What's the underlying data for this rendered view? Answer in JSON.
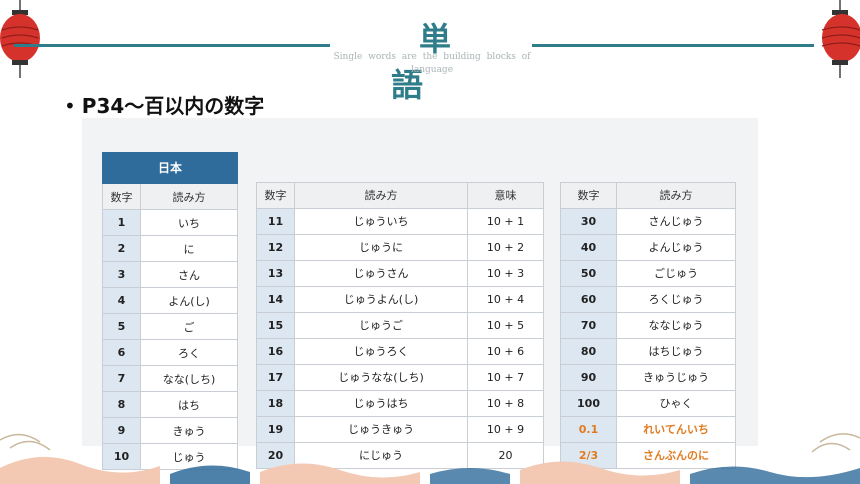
{
  "header": {
    "title": "単　語",
    "subtitle": "Single words are the building blocks of language"
  },
  "bullet": {
    "text": "P34～百以内の数字"
  },
  "table1": {
    "group_label": "日本",
    "headers": [
      "数字",
      "読み方"
    ],
    "rows": [
      [
        "1",
        "いち"
      ],
      [
        "2",
        "に"
      ],
      [
        "3",
        "さん"
      ],
      [
        "4",
        "よん(し)"
      ],
      [
        "5",
        "ご"
      ],
      [
        "6",
        "ろく"
      ],
      [
        "7",
        "なな(しち)"
      ],
      [
        "8",
        "はち"
      ],
      [
        "9",
        "きゅう"
      ],
      [
        "10",
        "じゅう"
      ]
    ]
  },
  "table2": {
    "headers": [
      "数字",
      "読み方",
      "意味"
    ],
    "rows": [
      [
        "11",
        "じゅういち",
        "10 + 1"
      ],
      [
        "12",
        "じゅうに",
        "10 + 2"
      ],
      [
        "13",
        "じゅうさん",
        "10 + 3"
      ],
      [
        "14",
        "じゅうよん(し)",
        "10 + 4"
      ],
      [
        "15",
        "じゅうご",
        "10 + 5"
      ],
      [
        "16",
        "じゅうろく",
        "10 + 6"
      ],
      [
        "17",
        "じゅうなな(しち)",
        "10 + 7"
      ],
      [
        "18",
        "じゅうはち",
        "10 + 8"
      ],
      [
        "19",
        "じゅうきゅう",
        "10 + 9"
      ],
      [
        "20",
        "にじゅう",
        "20"
      ]
    ]
  },
  "table3": {
    "headers": [
      "数字",
      "読み方"
    ],
    "rows": [
      [
        "30",
        "さんじゅう"
      ],
      [
        "40",
        "よんじゅう"
      ],
      [
        "50",
        "ごじゅう"
      ],
      [
        "60",
        "ろくじゅう"
      ],
      [
        "70",
        "ななじゅう"
      ],
      [
        "80",
        "はちじゅう"
      ],
      [
        "90",
        "きゅうじゅう"
      ],
      [
        "100",
        "ひゃく"
      ],
      [
        "0.1",
        "れいてんいち"
      ],
      [
        "2/3",
        "さんぶんのに"
      ]
    ],
    "highlight_rows": [
      8,
      9
    ]
  },
  "colors": {
    "accent": "#2f7d8a",
    "table_header": "#2f6b9b",
    "highlight": "#e07b1f"
  }
}
